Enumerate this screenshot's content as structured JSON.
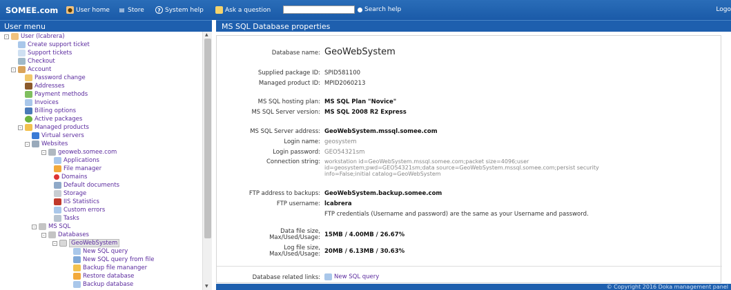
{
  "topbar": {
    "brand": "SOMEE.com",
    "user_home": "User home",
    "store": "Store",
    "system_help": "System help",
    "ask_question": "Ask a question",
    "search_value": "",
    "search_help": "Search help",
    "logout": "Logo"
  },
  "menu": {
    "title": "User menu",
    "items": [
      {
        "label": "User (lcabrera)",
        "icon": "user-icon"
      },
      {
        "label": "Create support ticket",
        "icon": "ticket-icon"
      },
      {
        "label": "Support tickets",
        "icon": "tickets-icon"
      },
      {
        "label": "Checkout",
        "icon": "checkout-icon"
      },
      {
        "label": "Account",
        "icon": "account-icon"
      },
      {
        "label": "Password change",
        "icon": "password-icon"
      },
      {
        "label": "Addresses",
        "icon": "addresses-icon"
      },
      {
        "label": "Payment methods",
        "icon": "payment-icon"
      },
      {
        "label": "Invoices",
        "icon": "invoices-icon"
      },
      {
        "label": "Billing options",
        "icon": "billing-icon"
      },
      {
        "label": "Active packages",
        "icon": "packages-icon"
      },
      {
        "label": "Managed products",
        "icon": "folder-icon"
      },
      {
        "label": "Virtual servers",
        "icon": "server-icon"
      },
      {
        "label": "Websites",
        "icon": "websites-icon"
      },
      {
        "label": "geoweb.somee.com",
        "icon": "site-icon"
      },
      {
        "label": "Applications",
        "icon": "applications-icon"
      },
      {
        "label": "File manager",
        "icon": "file-manager-icon"
      },
      {
        "label": "Domains",
        "icon": "domains-icon"
      },
      {
        "label": "Default documents",
        "icon": "documents-icon"
      },
      {
        "label": "Storage",
        "icon": "storage-icon"
      },
      {
        "label": "IIS Statistics",
        "icon": "statistics-icon"
      },
      {
        "label": "Custom errors",
        "icon": "errors-icon"
      },
      {
        "label": "Tasks",
        "icon": "tasks-icon"
      },
      {
        "label": "MS SQL",
        "icon": "mssql-icon"
      },
      {
        "label": "Databases",
        "icon": "databases-icon"
      },
      {
        "label": "GeoWebSystem",
        "icon": "database-icon"
      },
      {
        "label": "New SQL query",
        "icon": "query-icon"
      },
      {
        "label": "New SQL query from file",
        "icon": "query-file-icon"
      },
      {
        "label": "Backup file mananger",
        "icon": "backup-manager-icon"
      },
      {
        "label": "Restore database",
        "icon": "restore-icon"
      },
      {
        "label": "Backup database",
        "icon": "backup-icon"
      }
    ]
  },
  "main": {
    "title": "MS SQL Database properties",
    "db_name_label": "Database name:",
    "db_name": "GeoWebSystem",
    "pkg_id_label": "Supplied package ID:",
    "pkg_id": "SPID581100",
    "prod_id_label": "Managed product ID:",
    "prod_id": "MPID2060213",
    "plan_label": "MS SQL hosting plan:",
    "plan": "MS SQL Plan \"Novice\"",
    "version_label": "MS SQL Server version:",
    "version": "MS SQL 2008 R2 Express",
    "address_label": "MS SQL Server address:",
    "address": "GeoWebSystem.mssql.somee.com",
    "login_label": "Login name:",
    "login": "geosystem",
    "password_label": "Login password:",
    "password": "GEO54321sm",
    "conn_label": "Connection string:",
    "conn_line1": "workstation id=GeoWebSystem.mssql.somee.com;packet size=4096;user",
    "conn_line2": "id=geosystem;pwd=GEO54321sm;data source=GeoWebSystem.mssql.somee.com;persist security",
    "conn_line3": "info=False;initial catalog=GeoWebSystem",
    "ftp_addr_label": "FTP address to backups:",
    "ftp_addr": "GeoWebSystem.backup.somee.com",
    "ftp_user_label": "FTP username:",
    "ftp_user": "lcabrera",
    "ftp_note": "FTP credentials (Username and password) are the same as your Username and password.",
    "data_size_label1": "Data file size,",
    "data_size_label2": "Max/Used/Usage:",
    "data_size": "15MB / 4.00MB / 26.67%",
    "log_size_label1": "Log file size,",
    "log_size_label2": "Max/Used/Usage:",
    "log_size": "20MB / 6.13MB / 30.63%",
    "links_label": "Database related links:",
    "links_new_query": "New SQL query"
  },
  "footer": "© Copyright 2016 Doka management panel"
}
